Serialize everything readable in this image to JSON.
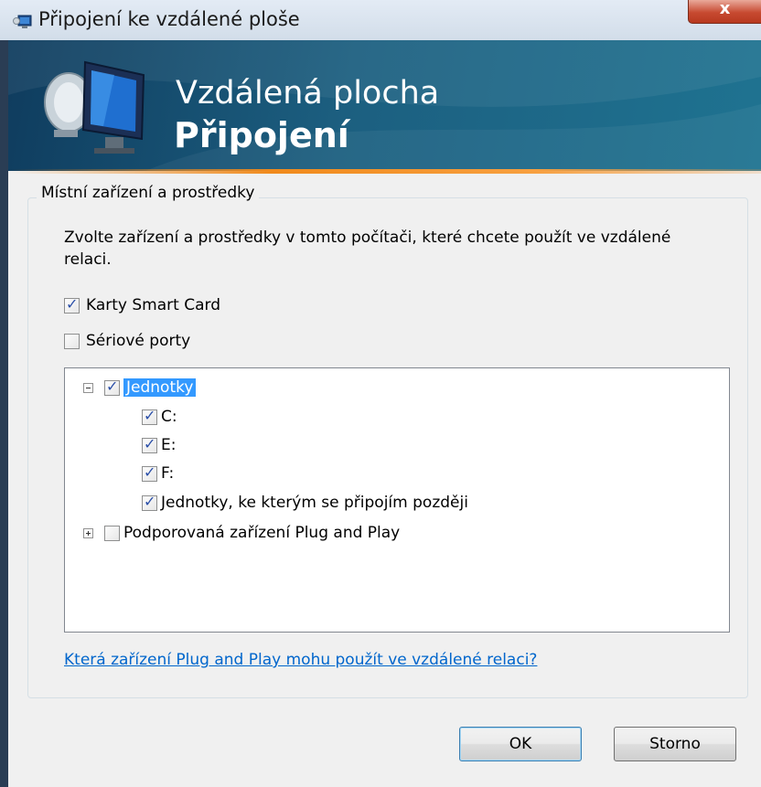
{
  "window": {
    "title": "Připojení ke vzdálené ploše",
    "close_label": "x"
  },
  "banner": {
    "subtitle": "Vzdálená plocha",
    "title": "Připojení"
  },
  "group": {
    "legend": "Místní zařízení a prostředky",
    "description": "Zvolte zařízení a prostředky v tomto počítači, které chcete použít ve vzdálené relaci.",
    "checkboxes": [
      {
        "label": "Karty Smart Card",
        "checked": true
      },
      {
        "label": "Sériové porty",
        "checked": false
      }
    ],
    "tree": {
      "drives": {
        "label": "Jednotky",
        "checked": true,
        "expanded": true,
        "selected": true
      },
      "drive_items": [
        {
          "label": "C:",
          "checked": true
        },
        {
          "label": "E:",
          "checked": true
        },
        {
          "label": "F:",
          "checked": true
        },
        {
          "label": "Jednotky, ke kterým se připojím později",
          "checked": true
        }
      ],
      "pnp": {
        "label": "Podporovaná zařízení Plug and Play",
        "checked": false,
        "expanded": false
      }
    },
    "help_link": "Která zařízení Plug and Play mohu použít ve vzdálené relaci?"
  },
  "buttons": {
    "ok": "OK",
    "cancel": "Storno"
  }
}
